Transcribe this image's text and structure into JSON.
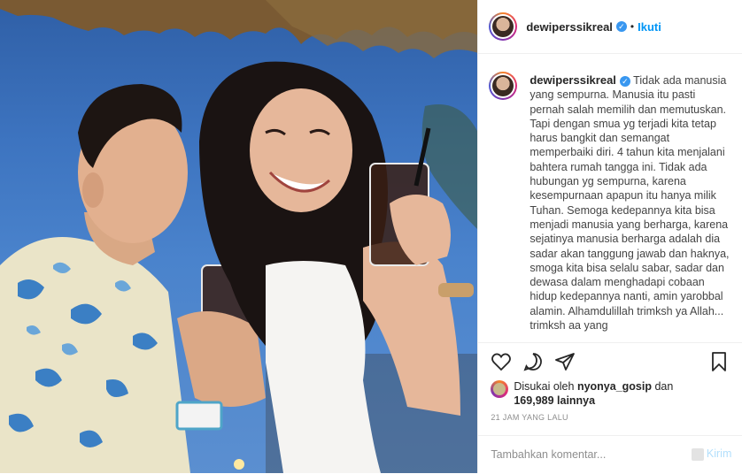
{
  "post": {
    "username": "dewiperssikreal",
    "follow_separator": "•",
    "follow_label": "Ikuti",
    "caption_text": "Tidak ada manusia yang sempurna. Manusia itu pasti pernah salah memilih dan memutuskan. Tapi dengan smua yg terjadi kita tetap harus bangkit dan semangat memperbaiki diri. 4 tahun kita menjalani bahtera rumah tangga ini. Tidak ada hubungan yg sempurna, karena kesempurnaan apapun itu hanya milik Tuhan. Semoga kedepannya kita bisa menjadi manusia yang berharga, karena sejatinya manusia berharga adalah dia sadar akan tanggung jawab dan haknya, smoga kita bisa selalu sabar, sadar dan dewasa dalam menghadapi cobaan hidup kedepannya nanti, amin yarobbal alamin. Alhamdulillah trimksh ya Allah... trimksh aa yang",
    "likes_prefix": "Disukai oleh",
    "likes_user": "nyonya_gosip",
    "likes_and": "dan",
    "likes_count": "169,989 lainnya",
    "timestamp": "21 JAM YANG LALU",
    "comment_placeholder": "Tambahkan komentar...",
    "send_label": "Kirim"
  },
  "icons": {
    "like": "heart-icon",
    "comment": "comment-icon",
    "share": "share-icon",
    "save": "bookmark-icon",
    "verified": "verified-badge-icon"
  },
  "colors": {
    "link_blue": "#0095f6",
    "verified_blue": "#3897f0",
    "muted": "#8e8e8e",
    "border": "#efefef"
  }
}
